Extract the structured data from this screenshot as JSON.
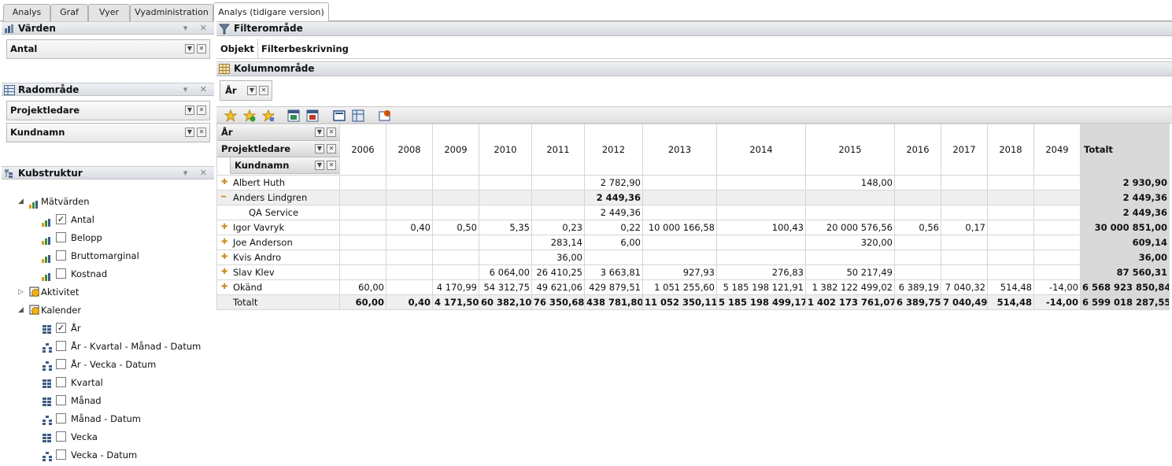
{
  "tabs": [
    "Analys",
    "Graf",
    "Vyer",
    "Vyadministration",
    "Analys (tidigare version)"
  ],
  "left": {
    "values_header": "Värden",
    "values_field": "Antal",
    "row_header": "Radområde",
    "row_fields": [
      "Projektledare",
      "Kundnamn"
    ],
    "cube_header": "Kubstruktur",
    "tree": {
      "measures": "Mätvärden",
      "measure_items": [
        {
          "label": "Antal",
          "checked": "✓"
        },
        {
          "label": "Belopp",
          "checked": ""
        },
        {
          "label": "Bruttomarginal",
          "checked": ""
        },
        {
          "label": "Kostnad",
          "checked": ""
        }
      ],
      "dim1": "Aktivitet",
      "dim2": "Kalender",
      "calendar_items": [
        {
          "label": "År",
          "checked": "✓"
        },
        {
          "label": "År - Kvartal - Månad - Datum",
          "checked": ""
        },
        {
          "label": "År - Vecka - Datum",
          "checked": ""
        },
        {
          "label": "Kvartal",
          "checked": ""
        },
        {
          "label": "Månad",
          "checked": ""
        },
        {
          "label": "Månad - Datum",
          "checked": ""
        },
        {
          "label": "Vecka",
          "checked": ""
        },
        {
          "label": "Vecka - Datum",
          "checked": ""
        }
      ]
    }
  },
  "right": {
    "filter_header": "Filterområde",
    "filter_cols": [
      "Objekt",
      "Filterbeskrivning"
    ],
    "column_header": "Kolumnområde",
    "column_field": "År"
  },
  "grid": {
    "corner": [
      "År",
      "Projektledare",
      "Kundnamn"
    ],
    "years": [
      "2006",
      "2008",
      "2009",
      "2010",
      "2011",
      "2012",
      "2013",
      "2014",
      "2015",
      "2016",
      "2017",
      "2018",
      "2049"
    ],
    "total_label": "Totalt",
    "rows": [
      {
        "label": "Albert Huth",
        "exp": "+",
        "values": [
          "",
          "",
          "",
          "",
          "",
          "2 782,90",
          "",
          "",
          "148,00",
          "",
          "",
          "",
          ""
        ],
        "total": "2 930,90"
      },
      {
        "label": "Anders Lindgren",
        "exp": "−",
        "values": [
          "",
          "",
          "",
          "",
          "",
          "2 449,36",
          "",
          "",
          "",
          "",
          "",
          "",
          ""
        ],
        "total": "2 449,36",
        "bold": true
      },
      {
        "label": "QA Service",
        "exp": "",
        "indent": true,
        "values": [
          "",
          "",
          "",
          "",
          "",
          "2 449,36",
          "",
          "",
          "",
          "",
          "",
          "",
          ""
        ],
        "total": "2 449,36"
      },
      {
        "label": "Igor Vavryk",
        "exp": "+",
        "values": [
          "",
          "0,40",
          "0,50",
          "5,35",
          "0,23",
          "0,22",
          "10 000 166,58",
          "100,43",
          "20 000 576,56",
          "0,56",
          "0,17",
          "",
          ""
        ],
        "total": "30 000 851,00"
      },
      {
        "label": "Joe Anderson",
        "exp": "+",
        "values": [
          "",
          "",
          "",
          "",
          "283,14",
          "6,00",
          "",
          "",
          "320,00",
          "",
          "",
          "",
          ""
        ],
        "total": "609,14"
      },
      {
        "label": "Kvis Andro",
        "exp": "+",
        "values": [
          "",
          "",
          "",
          "",
          "36,00",
          "",
          "",
          "",
          "",
          "",
          "",
          "",
          ""
        ],
        "total": "36,00"
      },
      {
        "label": "Slav Klev",
        "exp": "+",
        "values": [
          "",
          "",
          "",
          "6 064,00",
          "26 410,25",
          "3 663,81",
          "927,93",
          "276,83",
          "50 217,49",
          "",
          "",
          "",
          ""
        ],
        "total": "87 560,31"
      },
      {
        "label": "Okänd",
        "exp": "+",
        "values": [
          "60,00",
          "",
          "4 170,99",
          "54 312,75",
          "49 621,06",
          "429 879,51",
          "1 051 255,60",
          "5 185 198 121,91",
          "1 382 122 499,02",
          "6 389,19",
          "7 040,32",
          "514,48",
          "-14,00"
        ],
        "total": "6 568 923 850,84"
      }
    ],
    "grand": {
      "label": "Totalt",
      "values": [
        "60,00",
        "0,40",
        "4 171,50",
        "60 382,10",
        "76 350,68",
        "438 781,80",
        "11 052 350,11",
        "5 185 198 499,17",
        "1 402 173 761,07",
        "6 389,75",
        "7 040,49",
        "514,48",
        "-14,00"
      ],
      "total": "6 599 018 287,55"
    }
  }
}
